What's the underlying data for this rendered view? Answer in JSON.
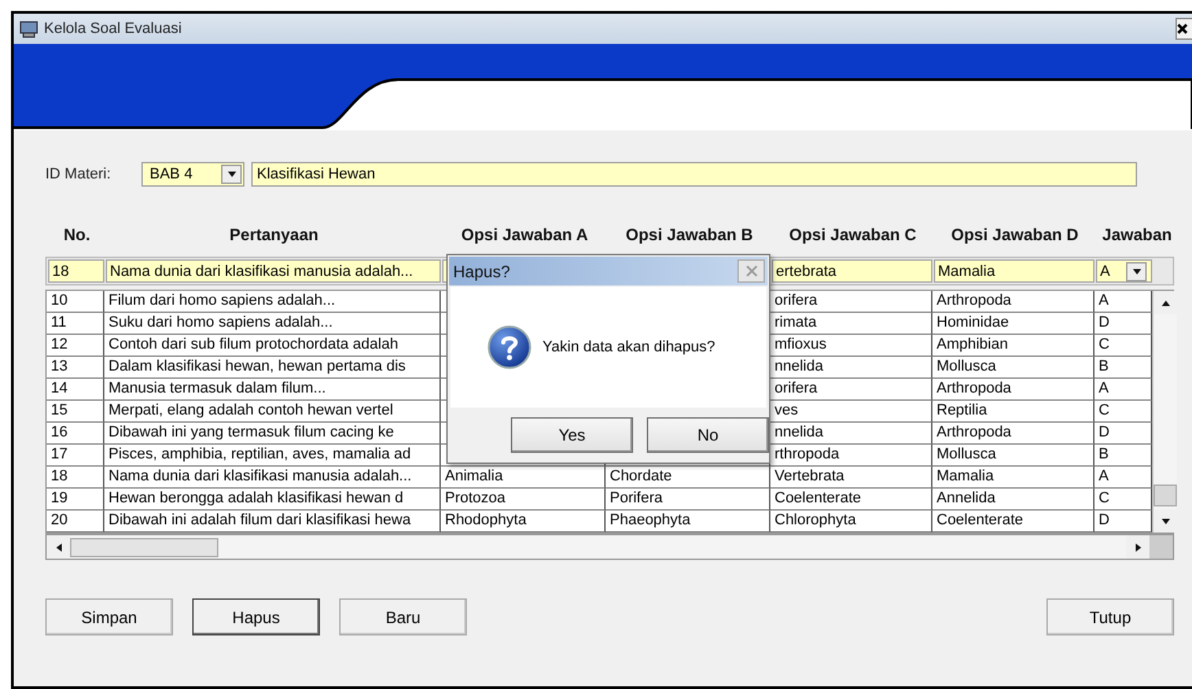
{
  "window": {
    "title": "Kelola Soal Evaluasi"
  },
  "id_materi": {
    "label": "ID Materi:",
    "code": "BAB 4",
    "name": "Klasifikasi Hewan"
  },
  "table": {
    "columns": [
      "No.",
      "Pertanyaan",
      "Opsi Jawaban A",
      "Opsi Jawaban B",
      "Opsi Jawaban C",
      "Opsi Jawaban D",
      "Jawaban"
    ],
    "edit_row": {
      "no": "18",
      "question": "Nama dunia dari klasifikasi manusia adalah...",
      "option_c": "ertebrata",
      "option_d": "Mamalia",
      "answer": "A"
    },
    "rows": [
      {
        "no": "10",
        "question": "Filum dari homo sapiens adalah...",
        "option_c": "orifera",
        "option_d": "Arthropoda",
        "answer": "A"
      },
      {
        "no": "11",
        "question": "Suku dari homo sapiens adalah...",
        "option_c": "rimata",
        "option_d": "Hominidae",
        "answer": "D"
      },
      {
        "no": "12",
        "question": "Contoh dari sub filum protochordata adalah",
        "option_c": "mfioxus",
        "option_d": "Amphibian",
        "answer": "C"
      },
      {
        "no": "13",
        "question": "Dalam klasifikasi hewan, hewan pertama dis",
        "option_c": "nnelida",
        "option_d": "Mollusca",
        "answer": "B"
      },
      {
        "no": "14",
        "question": "Manusia termasuk dalam filum...",
        "option_c": "orifera",
        "option_d": "Arthropoda",
        "answer": "A"
      },
      {
        "no": "15",
        "question": "Merpati, elang adalah contoh hewan vertel",
        "option_c": "ves",
        "option_d": "Reptilia",
        "answer": "C"
      },
      {
        "no": "16",
        "question": "Dibawah ini yang termasuk  filum cacing ke",
        "option_c": "nnelida",
        "option_d": "Arthropoda",
        "answer": "D"
      },
      {
        "no": "17",
        "question": "Pisces, amphibia, reptilian, aves, mamalia ad",
        "option_c": "rthropoda",
        "option_d": "Mollusca",
        "answer": "B"
      },
      {
        "no": "18",
        "question": "Nama dunia dari klasifikasi manusia adalah...",
        "option_a": "Animalia",
        "option_b": "Chordate",
        "option_c": "Vertebrata",
        "option_d": "Mamalia",
        "answer": "A"
      },
      {
        "no": "19",
        "question": "Hewan berongga adalah klasifikasi hewan d",
        "option_a": "Protozoa",
        "option_b": "Porifera",
        "option_c": "Coelenterate",
        "option_d": "Annelida",
        "answer": "C"
      },
      {
        "no": "20",
        "question": "Dibawah ini adalah filum dari klasifikasi hewa",
        "option_a": "Rhodophyta",
        "option_b": "Phaeophyta",
        "option_c": "Chlorophyta",
        "option_d": "Coelenterate",
        "answer": "D"
      }
    ]
  },
  "dialog": {
    "title": "Hapus?",
    "message": "Yakin data akan dihapus?",
    "buttons": [
      "Yes",
      "No"
    ]
  },
  "buttons": [
    {
      "label": "Simpan",
      "focused": false
    },
    {
      "label": "Hapus",
      "focused": true
    },
    {
      "label": "Baru",
      "focused": false
    },
    {
      "label": "Tutup",
      "focused": false
    }
  ]
}
